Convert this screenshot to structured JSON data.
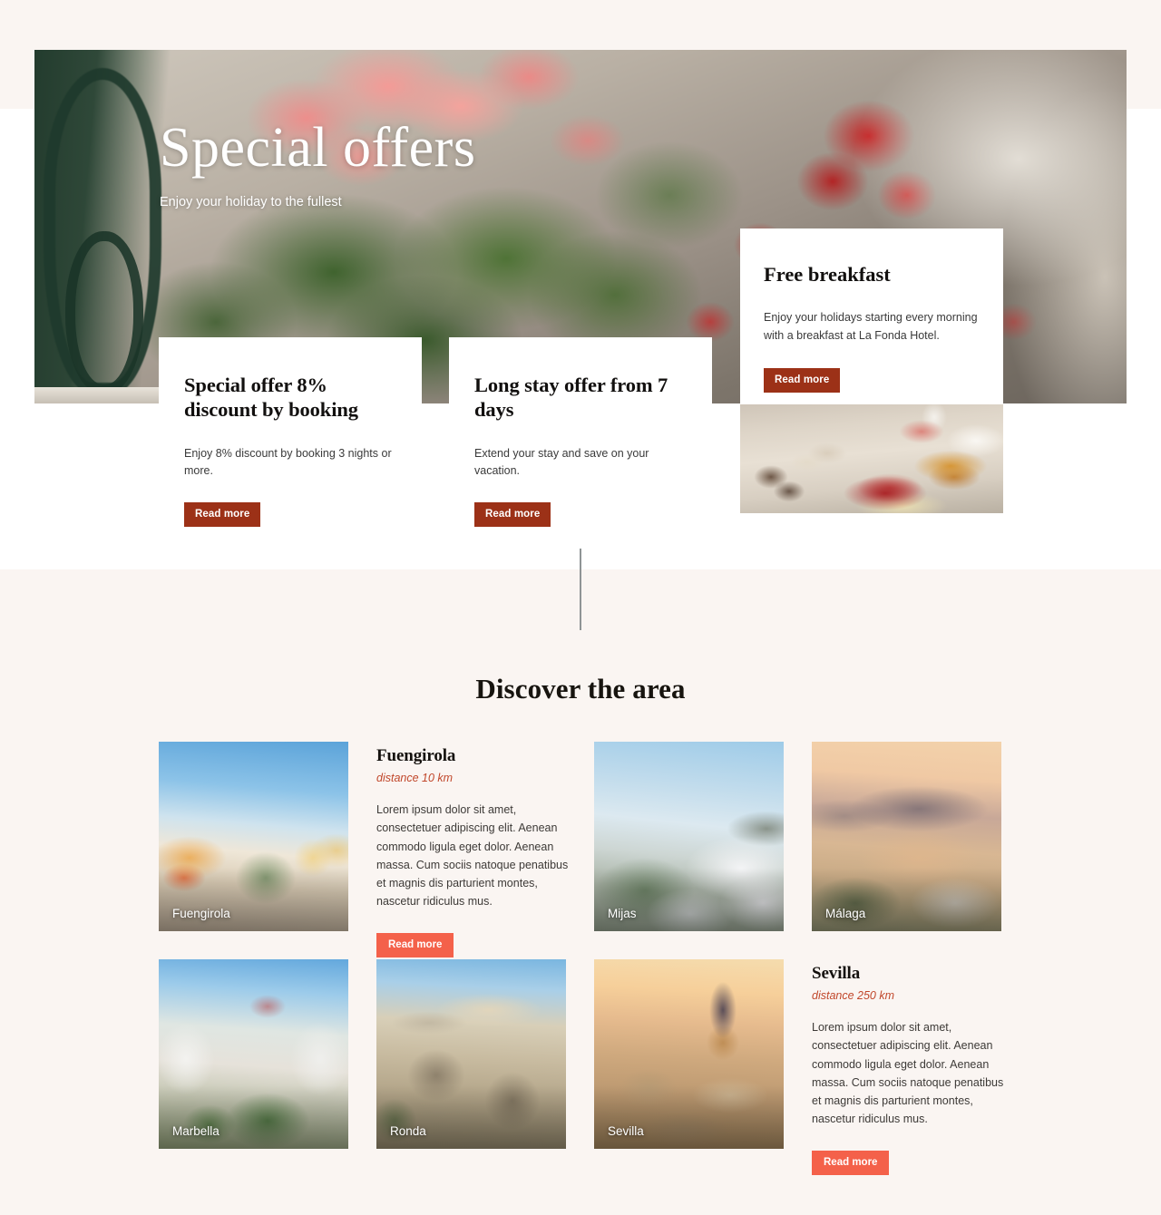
{
  "hero": {
    "title": "Special offers",
    "subtitle": "Enjoy your holiday to the fullest",
    "image_alt": "pink-and-red-geraniums-on-andalusian-street"
  },
  "offers": [
    {
      "title": "Special offer 8% discount by booking",
      "description": "Enjoy 8% discount by booking 3 nights or more.",
      "button": "Read more"
    },
    {
      "title": "Long stay offer from 7 days",
      "description": "Extend your stay and save on your vacation.",
      "button": "Read more"
    }
  ],
  "breakfast": {
    "title": "Free breakfast",
    "description": "Enjoy your holidays starting every morning with a breakfast at La Fonda Hotel.",
    "button": "Read more",
    "image_alt": "breakfast-buffet-pastries-and-cakes"
  },
  "discover": {
    "title": "Discover the area",
    "tiles": [
      {
        "caption": "Fuengirola"
      },
      {
        "caption": "Mijas"
      },
      {
        "caption": "Málaga"
      },
      {
        "caption": "Marbella"
      },
      {
        "caption": "Ronda"
      },
      {
        "caption": "Sevilla"
      }
    ],
    "descriptions": [
      {
        "name": "Fuengirola",
        "distance": "distance 10 km",
        "body": "Lorem ipsum dolor sit amet, consectetuer adipiscing elit. Aenean commodo ligula eget dolor. Aenean massa. Cum sociis natoque penatibus et magnis dis parturient montes, nascetur ridiculus mus.",
        "button": "Read more"
      },
      {
        "name": "Sevilla",
        "distance": "distance 250 km",
        "body": "Lorem ipsum dolor sit amet, consectetuer adipiscing elit. Aenean commodo ligula eget dolor. Aenean massa. Cum sociis natoque penatibus et magnis dis parturient montes, nascetur ridiculus mus.",
        "button": "Read more"
      }
    ]
  },
  "colors": {
    "page_background": "#faf5f2",
    "card_background": "#ffffff",
    "button_dark": "#9c3117",
    "button_coral": "#f4614a",
    "distance_text": "#c1472b",
    "heading": "#14110e",
    "divider": "#8f9495"
  }
}
